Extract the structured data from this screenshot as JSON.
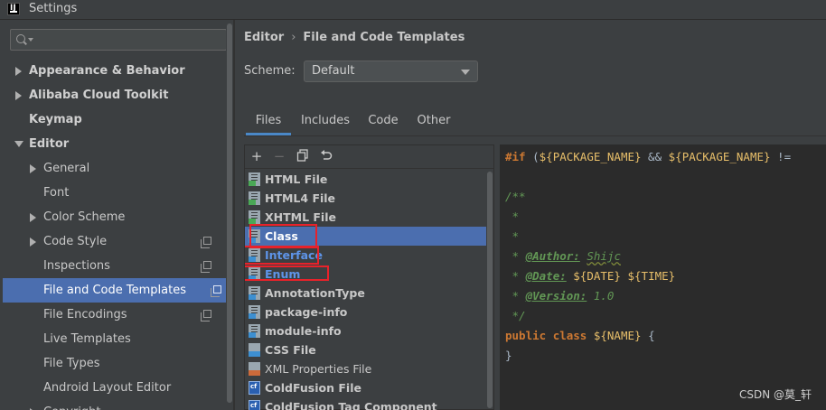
{
  "window": {
    "title": "Settings",
    "logo_text": "IJ"
  },
  "search": {
    "placeholder": ""
  },
  "sidebar": {
    "items": [
      {
        "label": "Appearance & Behavior"
      },
      {
        "label": "Alibaba Cloud Toolkit"
      },
      {
        "label": "Keymap"
      },
      {
        "label": "Editor"
      },
      {
        "label": "General"
      },
      {
        "label": "Font"
      },
      {
        "label": "Color Scheme"
      },
      {
        "label": "Code Style"
      },
      {
        "label": "Inspections"
      },
      {
        "label": "File and Code Templates"
      },
      {
        "label": "File Encodings"
      },
      {
        "label": "Live Templates"
      },
      {
        "label": "File Types"
      },
      {
        "label": "Android Layout Editor"
      },
      {
        "label": "Copyright"
      }
    ]
  },
  "breadcrumb": {
    "parent": "Editor",
    "separator": "›",
    "current": "File and Code Templates"
  },
  "scheme": {
    "label": "Scheme:",
    "value": "Default"
  },
  "tabs": [
    {
      "label": "Files"
    },
    {
      "label": "Includes"
    },
    {
      "label": "Code"
    },
    {
      "label": "Other"
    }
  ],
  "toolbar": {
    "add": "+",
    "remove": "−"
  },
  "files": [
    {
      "label": "HTML File"
    },
    {
      "label": "HTML4 File"
    },
    {
      "label": "XHTML File"
    },
    {
      "label": "Class"
    },
    {
      "label": "Interface"
    },
    {
      "label": "Enum"
    },
    {
      "label": "AnnotationType"
    },
    {
      "label": "package-info"
    },
    {
      "label": "module-info"
    },
    {
      "label": "CSS File"
    },
    {
      "label": "XML Properties File"
    },
    {
      "label": "ColdFusion File"
    },
    {
      "label": "ColdFusion Tag Component"
    }
  ],
  "code": {
    "line1": {
      "kw_if": "#if",
      "p1": " (",
      "v1": "${PACKAGE_NAME}",
      "amp": " && ",
      "v2": "${PACKAGE_NAME}",
      "ne": " !="
    },
    "open": "/**",
    "star": " *",
    "author_tag": "@Author:",
    "author_val": "Shijc",
    "date_tag": "@Date:",
    "date_val": "${DATE}",
    "time_val": "${TIME}",
    "version_tag": "@Version:",
    "version_val": "1.0",
    "close": " */",
    "public": "public",
    "class": "class",
    "name": "${NAME}",
    "brace_open": " {",
    "brace_close": "}"
  },
  "watermark": "CSDN @莫_轩",
  "colors": {
    "selection": "#4b6eaf",
    "highlight_box": "#e8222a",
    "tab_underline": "#4a88c7"
  }
}
